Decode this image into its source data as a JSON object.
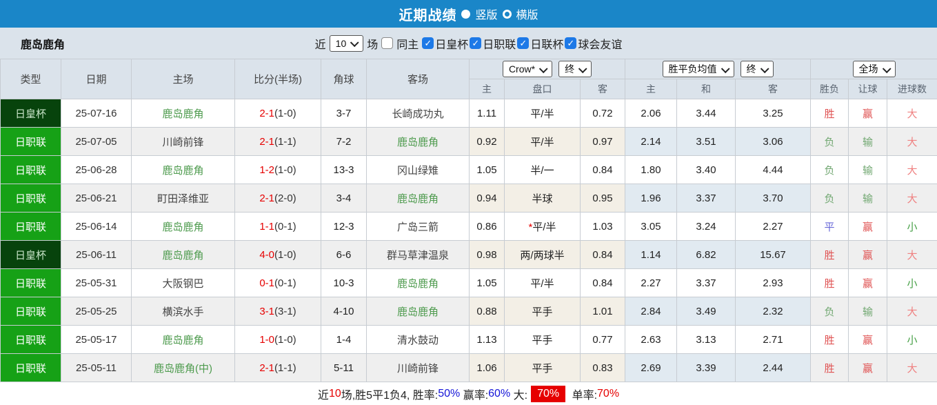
{
  "title_bar": {
    "title": "近期战绩",
    "vertical_label": "竖版",
    "horizontal_label": "横版",
    "selected_layout": "竖版"
  },
  "filter_bar": {
    "team_name": "鹿岛鹿角",
    "near_label": "近",
    "count_value": "10",
    "matches_label": "场",
    "same_home": {
      "label": "同主",
      "checked": false
    },
    "competitions": [
      {
        "label": "日皇杯",
        "checked": true
      },
      {
        "label": "日职联",
        "checked": true
      },
      {
        "label": "日联杯",
        "checked": true
      },
      {
        "label": "球会友谊",
        "checked": true
      }
    ]
  },
  "colors": {
    "topbar_blue": "#1a86c8",
    "panel_gray_blue": "#dbe3eb",
    "cup_green_dark": "#07430c",
    "league_green": "#16a116",
    "team_highlight_green": "#4e9b4e",
    "score_red": "#e60000",
    "win_red": "#e05454",
    "lose_green": "#72a872",
    "draw_blue": "#6868d8",
    "big_red": "#ef8080",
    "small_green": "#46a046",
    "checkbox_blue": "#1d79e7"
  },
  "table": {
    "main_headers": [
      "类型",
      "日期",
      "主场",
      "比分(半场)",
      "角球",
      "客场"
    ],
    "sub_headers": [
      "主",
      "盘口",
      "客",
      "主",
      "和",
      "客",
      "胜负",
      "让球",
      "进球数"
    ],
    "selectors": {
      "company": "Crow*",
      "company_period": "终",
      "europe": "胜平负均值",
      "europe_period": "终",
      "scope": "全场"
    },
    "rows": [
      {
        "type": "日皇杯",
        "type_tone": "cup",
        "date": "25-07-16",
        "home": "鹿岛鹿角",
        "home_highlight": true,
        "score": "2-1",
        "half_score": "(1-0)",
        "corners": "3-7",
        "away": "长崎成功丸",
        "away_highlight": false,
        "asian_home": "1.11",
        "handicap_mark": "",
        "handicap": "平/半",
        "asian_away": "0.72",
        "euro_home": "2.06",
        "euro_draw": "3.44",
        "euro_away": "3.25",
        "result": "胜",
        "result_tone": "red",
        "let_result": "赢",
        "let_tone": "red",
        "goals": "大",
        "goals_tone": "red-light"
      },
      {
        "type": "日职联",
        "type_tone": "league",
        "date": "25-07-05",
        "home": "川崎前锋",
        "home_highlight": false,
        "score": "2-1",
        "half_score": "(1-1)",
        "corners": "7-2",
        "away": "鹿岛鹿角",
        "away_highlight": true,
        "asian_home": "0.92",
        "handicap_mark": "",
        "handicap": "平/半",
        "asian_away": "0.97",
        "euro_home": "2.14",
        "euro_draw": "3.51",
        "euro_away": "3.06",
        "result": "负",
        "result_tone": "green",
        "let_result": "输",
        "let_tone": "green",
        "goals": "大",
        "goals_tone": "red-light"
      },
      {
        "type": "日职联",
        "type_tone": "league",
        "date": "25-06-28",
        "home": "鹿岛鹿角",
        "home_highlight": true,
        "score": "1-2",
        "half_score": "(1-0)",
        "corners": "13-3",
        "away": "冈山绿雉",
        "away_highlight": false,
        "asian_home": "1.05",
        "handicap_mark": "",
        "handicap": "半/一",
        "asian_away": "0.84",
        "euro_home": "1.80",
        "euro_draw": "3.40",
        "euro_away": "4.44",
        "result": "负",
        "result_tone": "green",
        "let_result": "输",
        "let_tone": "green",
        "goals": "大",
        "goals_tone": "red-light"
      },
      {
        "type": "日职联",
        "type_tone": "league",
        "date": "25-06-21",
        "home": "町田泽维亚",
        "home_highlight": false,
        "score": "2-1",
        "half_score": "(2-0)",
        "corners": "3-4",
        "away": "鹿岛鹿角",
        "away_highlight": true,
        "asian_home": "0.94",
        "handicap_mark": "",
        "handicap": "半球",
        "asian_away": "0.95",
        "euro_home": "1.96",
        "euro_draw": "3.37",
        "euro_away": "3.70",
        "result": "负",
        "result_tone": "green",
        "let_result": "输",
        "let_tone": "green",
        "goals": "大",
        "goals_tone": "red-light"
      },
      {
        "type": "日职联",
        "type_tone": "league",
        "date": "25-06-14",
        "home": "鹿岛鹿角",
        "home_highlight": true,
        "score": "1-1",
        "half_score": "(0-1)",
        "corners": "12-3",
        "away": "广岛三箭",
        "away_highlight": false,
        "asian_home": "0.86",
        "handicap_mark": "*",
        "handicap": "平/半",
        "asian_away": "1.03",
        "euro_home": "3.05",
        "euro_draw": "3.24",
        "euro_away": "2.27",
        "result": "平",
        "result_tone": "blue",
        "let_result": "赢",
        "let_tone": "red",
        "goals": "小",
        "goals_tone": "green-strong"
      },
      {
        "type": "日皇杯",
        "type_tone": "cup",
        "date": "25-06-11",
        "home": "鹿岛鹿角",
        "home_highlight": true,
        "score": "4-0",
        "half_score": "(1-0)",
        "corners": "6-6",
        "away": "群马草津温泉",
        "away_highlight": false,
        "asian_home": "0.98",
        "handicap_mark": "",
        "handicap": "两/两球半",
        "asian_away": "0.84",
        "euro_home": "1.14",
        "euro_draw": "6.82",
        "euro_away": "15.67",
        "result": "胜",
        "result_tone": "red",
        "let_result": "赢",
        "let_tone": "red",
        "goals": "大",
        "goals_tone": "red-light"
      },
      {
        "type": "日职联",
        "type_tone": "league",
        "date": "25-05-31",
        "home": "大阪钢巴",
        "home_highlight": false,
        "score": "0-1",
        "half_score": "(0-1)",
        "corners": "10-3",
        "away": "鹿岛鹿角",
        "away_highlight": true,
        "asian_home": "1.05",
        "handicap_mark": "",
        "handicap": "平/半",
        "asian_away": "0.84",
        "euro_home": "2.27",
        "euro_draw": "3.37",
        "euro_away": "2.93",
        "result": "胜",
        "result_tone": "red",
        "let_result": "赢",
        "let_tone": "red",
        "goals": "小",
        "goals_tone": "green-strong"
      },
      {
        "type": "日职联",
        "type_tone": "league",
        "date": "25-05-25",
        "home": "横滨水手",
        "home_highlight": false,
        "score": "3-1",
        "half_score": "(3-1)",
        "corners": "4-10",
        "away": "鹿岛鹿角",
        "away_highlight": true,
        "asian_home": "0.88",
        "handicap_mark": "",
        "handicap": "平手",
        "asian_away": "1.01",
        "euro_home": "2.84",
        "euro_draw": "3.49",
        "euro_away": "2.32",
        "result": "负",
        "result_tone": "green",
        "let_result": "输",
        "let_tone": "green",
        "goals": "大",
        "goals_tone": "red-light"
      },
      {
        "type": "日职联",
        "type_tone": "league",
        "date": "25-05-17",
        "home": "鹿岛鹿角",
        "home_highlight": true,
        "score": "1-0",
        "half_score": "(1-0)",
        "corners": "1-4",
        "away": "清水鼓动",
        "away_highlight": false,
        "asian_home": "1.13",
        "handicap_mark": "",
        "handicap": "平手",
        "asian_away": "0.77",
        "euro_home": "2.63",
        "euro_draw": "3.13",
        "euro_away": "2.71",
        "result": "胜",
        "result_tone": "red",
        "let_result": "赢",
        "let_tone": "red",
        "goals": "小",
        "goals_tone": "green-strong"
      },
      {
        "type": "日职联",
        "type_tone": "league",
        "date": "25-05-11",
        "home": "鹿岛鹿角(中)",
        "home_highlight": true,
        "score": "2-1",
        "half_score": "(1-1)",
        "corners": "5-11",
        "away": "川崎前锋",
        "away_highlight": false,
        "asian_home": "1.06",
        "handicap_mark": "",
        "handicap": "平手",
        "asian_away": "0.83",
        "euro_home": "2.69",
        "euro_draw": "3.39",
        "euro_away": "2.44",
        "result": "胜",
        "result_tone": "red",
        "let_result": "赢",
        "let_tone": "red",
        "goals": "大",
        "goals_tone": "red-light"
      }
    ]
  },
  "footer": {
    "segments": [
      {
        "text": "近",
        "tone": "plain"
      },
      {
        "text": "10",
        "tone": "red"
      },
      {
        "text": "场,胜5平1负4, 胜率:",
        "tone": "plain"
      },
      {
        "text": "50%",
        "tone": "blue"
      },
      {
        "text": " 赢率:",
        "tone": "plain"
      },
      {
        "text": "60%",
        "tone": "blue"
      },
      {
        "text": " 大:",
        "tone": "plain"
      },
      {
        "text": "70%",
        "tone": "highlight"
      },
      {
        "text": " 单率:",
        "tone": "plain"
      },
      {
        "text": "70%",
        "tone": "red"
      }
    ]
  }
}
